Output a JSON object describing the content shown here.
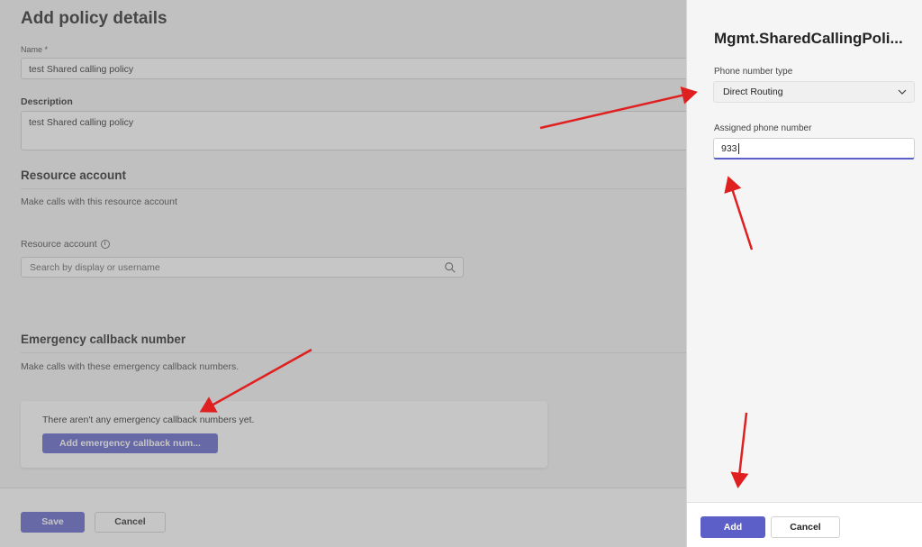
{
  "page": {
    "title": "Add policy details",
    "name_label": "Name *",
    "name_value": "test Shared calling policy",
    "description_label": "Description",
    "description_value": "test Shared calling policy",
    "resource_section_title": "Resource account",
    "resource_section_desc": "Make calls with this resource account",
    "resource_field_label": "Resource account",
    "resource_search_placeholder": "Search by display or username",
    "emergency_section_title": "Emergency callback number",
    "emergency_section_desc": "Make calls with these emergency callback numbers.",
    "emergency_empty_text": "There aren't any emergency callback numbers yet.",
    "emergency_add_button": "Add emergency callback num...",
    "save_button": "Save",
    "cancel_button": "Cancel"
  },
  "panel": {
    "title": "Mgmt.SharedCallingPoli...",
    "phone_type_label": "Phone number type",
    "phone_type_value": "Direct Routing",
    "assigned_label": "Assigned phone number",
    "assigned_value": "933",
    "add_button": "Add",
    "cancel_button": "Cancel"
  },
  "icons": {
    "search": "search-icon",
    "info": "info-icon",
    "chevron": "chevron-down-icon"
  },
  "colors": {
    "accent": "#5b5fc7",
    "annotation_arrow": "#e02020"
  }
}
